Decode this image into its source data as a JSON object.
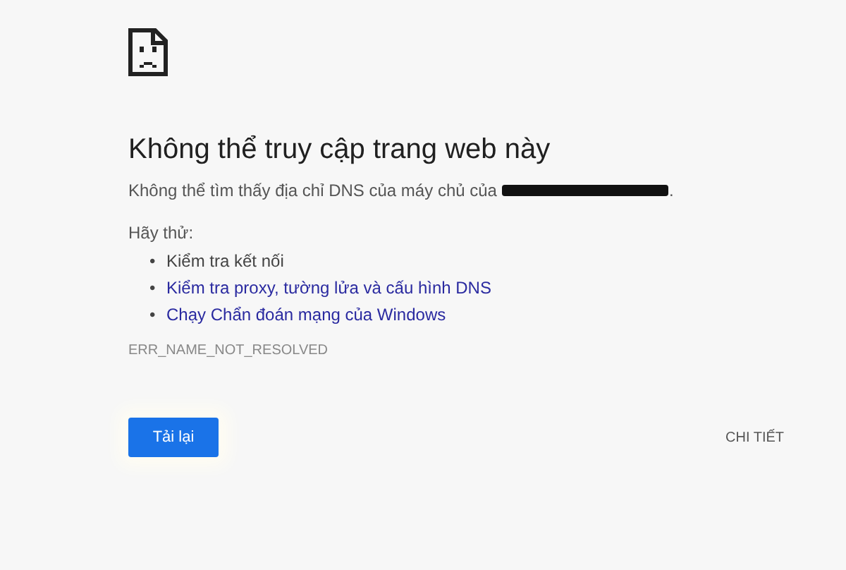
{
  "title": "Không thể truy cập trang web này",
  "message": {
    "text": "Không thể tìm thấy địa chỉ DNS của máy chủ của",
    "end": "."
  },
  "suggestions": {
    "heading": "Hãy thử:",
    "items": [
      {
        "bullet": "•",
        "label": "Kiểm tra kết nối",
        "kind": "text"
      },
      {
        "bullet": "•",
        "label": "Kiểm tra proxy, tường lửa và cấu hình DNS",
        "kind": "link"
      },
      {
        "bullet": "•",
        "label": "Chạy Chẩn đoán mạng của Windows",
        "kind": "link"
      }
    ]
  },
  "error_code": "ERR_NAME_NOT_RESOLVED",
  "buttons": {
    "reload": "Tải lại",
    "details": "CHI TIẾT"
  }
}
